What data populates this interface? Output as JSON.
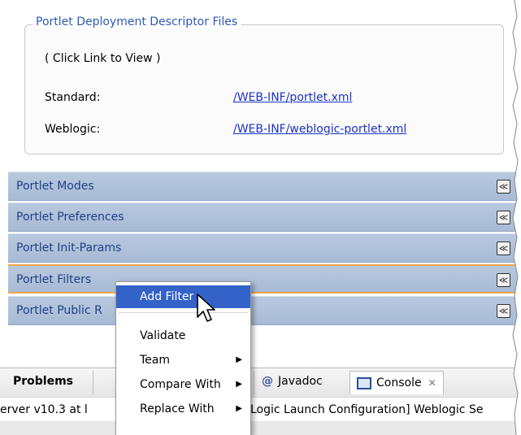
{
  "descriptor": {
    "title": "Portlet Deployment Descriptor Files",
    "hint": "( Click Link to View )",
    "rows": [
      {
        "label": "Standard:",
        "link": "/WEB-INF/portlet.xml"
      },
      {
        "label": "Weblogic:",
        "link": "/WEB-INF/weblogic-portlet.xml"
      }
    ]
  },
  "sections": [
    {
      "label": "Portlet Modes"
    },
    {
      "label": "Portlet Preferences"
    },
    {
      "label": "Portlet Init-Params"
    },
    {
      "label": "Portlet Filters"
    },
    {
      "label": "Portlet Public R"
    }
  ],
  "context_menu": {
    "items": [
      {
        "label": "Add Filter",
        "has_submenu": false
      },
      {
        "label": "Validate",
        "has_submenu": false
      },
      {
        "label": "Team",
        "has_submenu": true
      },
      {
        "label": "Compare With",
        "has_submenu": true
      },
      {
        "label": "Replace With",
        "has_submenu": true
      }
    ]
  },
  "bottom_panel": {
    "tabs": {
      "problems": "Problems",
      "javadoc": "Javadoc",
      "console": "Console"
    },
    "console_text_left": "erver v10.3 at l",
    "console_text_right": "Logic Launch Configuration] Weblogic Se"
  },
  "colors": {
    "section_bar": "#a8bbd5",
    "section_text": "#1f3f86",
    "menu_highlight": "#3363c8",
    "focus_border": "#f2a74a",
    "group_title": "#2f5ab4",
    "link": "#1a33c8"
  }
}
